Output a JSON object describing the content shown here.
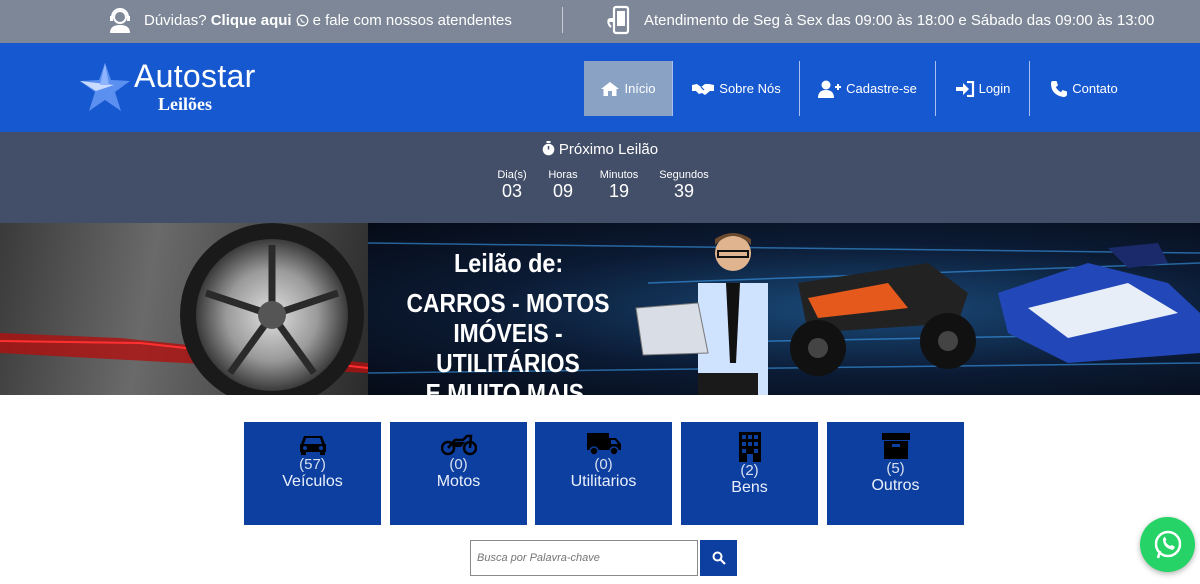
{
  "topbar": {
    "doubts_prefix": "Dúvidas?",
    "doubts_link": "Clique aqui",
    "doubts_suffix": "e fale com nossos atendentes",
    "hours": "Atendimento de Seg à Sex das 09:00 às 18:00 e Sábado das 09:00 às 13:00"
  },
  "logo": {
    "title": "Autostar",
    "subtitle": "Leilões"
  },
  "nav": {
    "items": [
      {
        "label": "Início",
        "icon": "home-icon",
        "active": true
      },
      {
        "label": "Sobre Nós",
        "icon": "handshake-icon"
      },
      {
        "label": "Cadastre-se",
        "icon": "user-plus-icon"
      },
      {
        "label": "Login",
        "icon": "sign-in-icon"
      },
      {
        "label": "Contato",
        "icon": "phone-icon"
      }
    ]
  },
  "countdown": {
    "title": "Próximo Leilão",
    "units": [
      {
        "label": "Dia(s)",
        "value": "03"
      },
      {
        "label": "Horas",
        "value": "09"
      },
      {
        "label": "Minutos",
        "value": "19"
      },
      {
        "label": "Segundos",
        "value": "39"
      }
    ]
  },
  "banner": {
    "heading": "Leilão de:",
    "line1": "CARROS - MOTOS",
    "line2": "IMÓVEIS - UTILITÁRIOS",
    "line3": "E MUITO MAIS."
  },
  "categories": [
    {
      "count": "(57)",
      "label": "Veículos",
      "icon": "car-icon"
    },
    {
      "count": "(0)",
      "label": "Motos",
      "icon": "motorcycle-icon"
    },
    {
      "count": "(0)",
      "label": "Utilitarios",
      "icon": "truck-icon"
    },
    {
      "count": "(2)",
      "label": "Bens",
      "icon": "building-icon"
    },
    {
      "count": "(5)",
      "label": "Outros",
      "icon": "archive-icon"
    }
  ],
  "search": {
    "placeholder": "Busca por Palavra-chave"
  },
  "colors": {
    "topbar": "#7d8797",
    "header": "#1658cf",
    "countdown": "#434f68",
    "category": "#0d3fa0",
    "whatsapp": "#25d366"
  }
}
